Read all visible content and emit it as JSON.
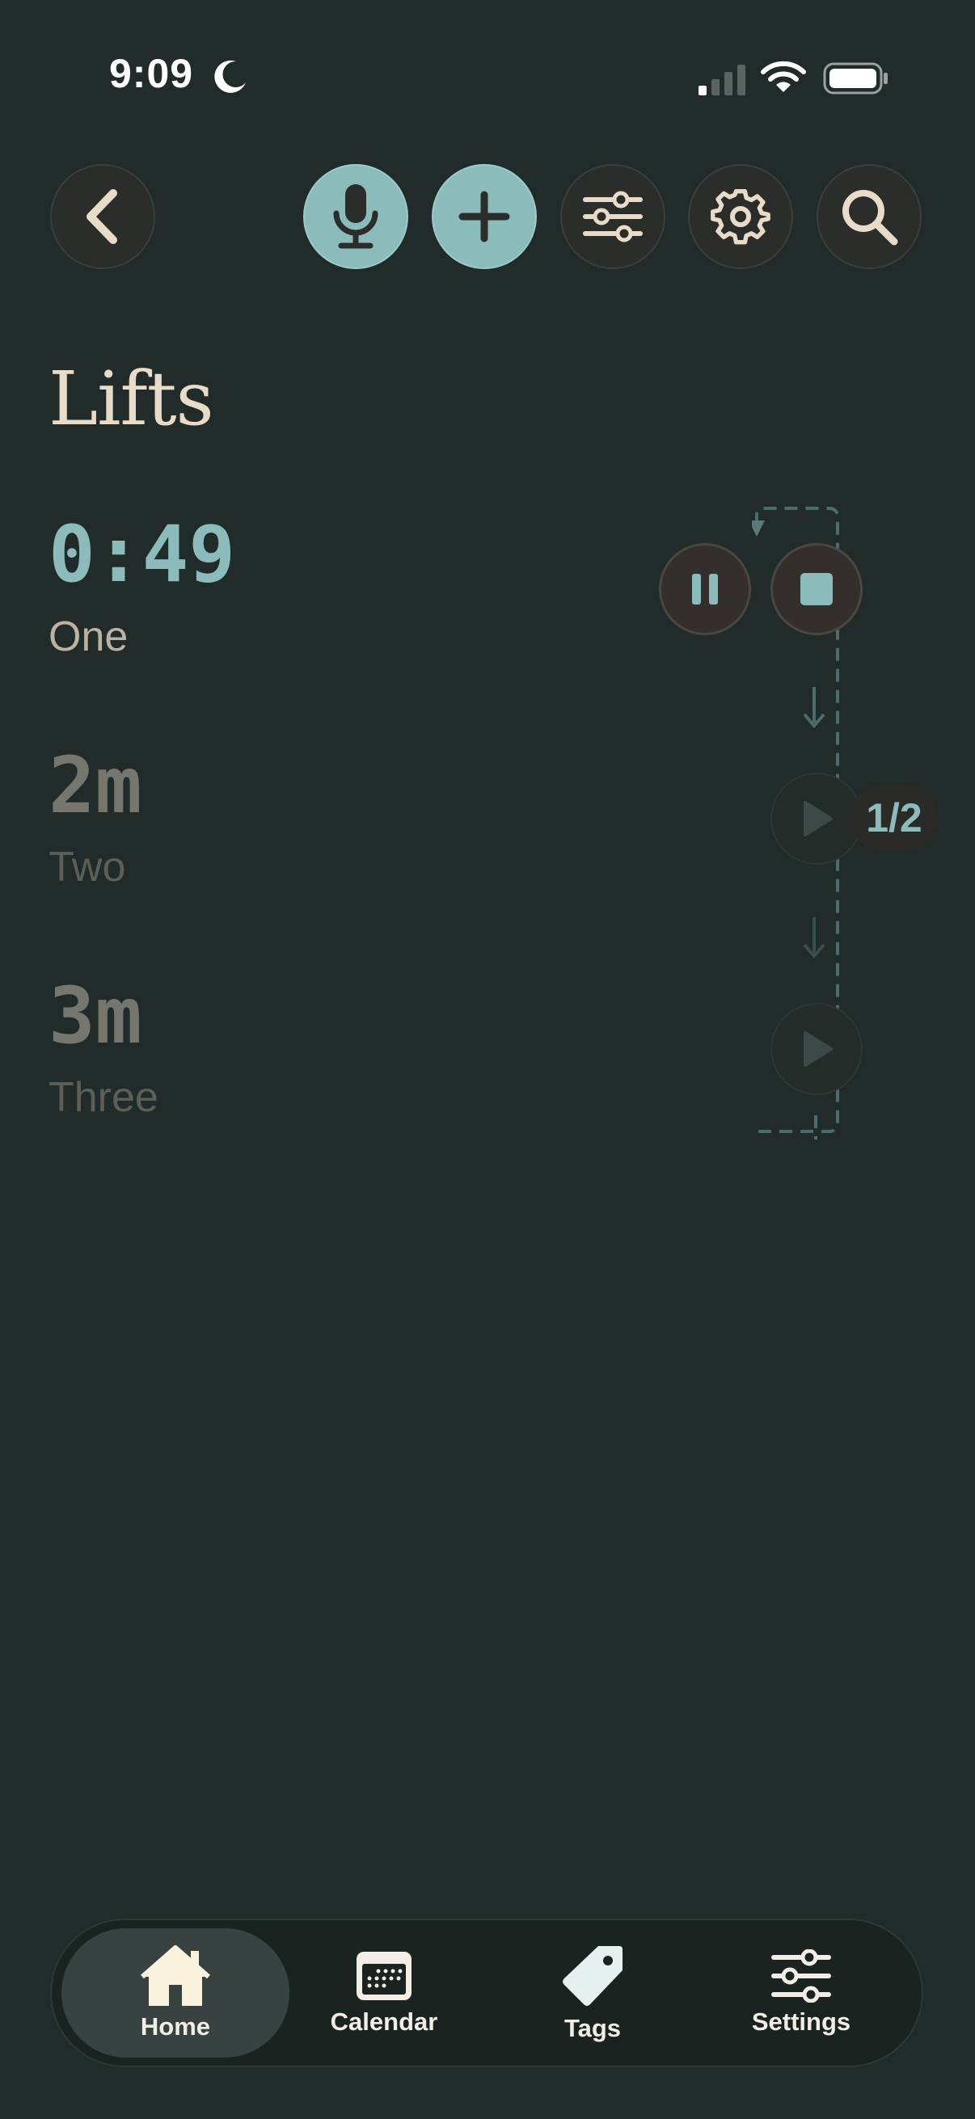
{
  "status_bar": {
    "time": "9:09",
    "icons": [
      "moon-icon",
      "cellular-signal-icon",
      "wifi-icon",
      "battery-icon"
    ]
  },
  "toolbar": {
    "buttons": [
      "back-icon",
      "microphone-icon",
      "plus-icon",
      "sliders-icon",
      "gear-icon",
      "search-icon"
    ]
  },
  "page": {
    "title": "Lifts"
  },
  "timers": [
    {
      "value": "0:49",
      "label": "One",
      "state": "running"
    },
    {
      "value": "2m",
      "label": "Two",
      "state": "queued"
    },
    {
      "value": "3m",
      "label": "Three",
      "state": "queued"
    }
  ],
  "sequence": {
    "counter": "1/2"
  },
  "tab_bar": {
    "tabs": [
      {
        "label": "Home",
        "icon": "house-icon",
        "active": true
      },
      {
        "label": "Calendar",
        "icon": "calendar-icon",
        "active": false
      },
      {
        "label": "Tags",
        "icon": "tag-icon",
        "active": false
      },
      {
        "label": "Settings",
        "icon": "sliders-icon",
        "active": false
      }
    ]
  },
  "colors": {
    "background": "#212b29",
    "accent": "#8bbcbb",
    "text_primary": "#e8dcc8"
  }
}
